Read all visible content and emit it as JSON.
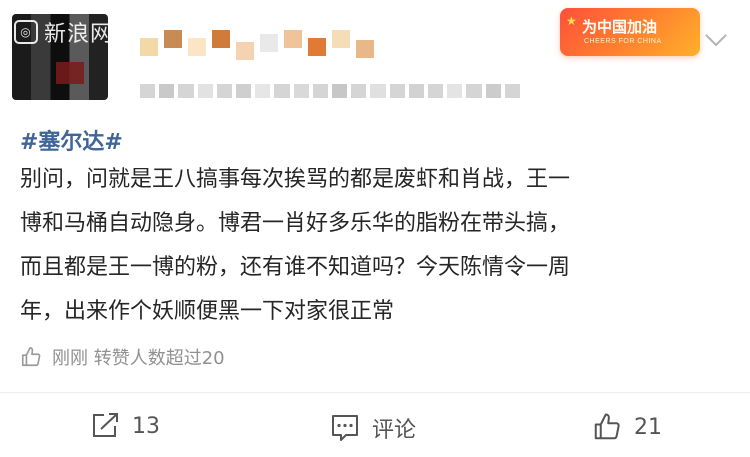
{
  "watermark": {
    "icon": "app-logo-icon",
    "text": "新浪网"
  },
  "badge": {
    "title": "为中国加油",
    "subtitle": "CHEERS FOR CHINA"
  },
  "post": {
    "topic": "#塞尔达#",
    "lines": [
      "别问，问就是王八搞事每次挨骂的都是废虾和肖战，王一",
      "博和马桶自动隐身。博君一肖好多乐华的脂粉在带头搞，",
      "而且都是王一博的粉，还有谁不知道吗？今天陈情令一周",
      "年，出来作个妖顺便黑一下对家很正常"
    ],
    "likes_info": "刚刚 转赞人数超过20"
  },
  "actions": {
    "repost_count": "13",
    "comment_label": "评论",
    "like_count": "21"
  },
  "icons": {
    "repost": "repost-icon",
    "comment": "comment-icon",
    "like": "thumbs-up-icon",
    "more": "chevron-down-icon"
  },
  "colors": {
    "topic": "#406599",
    "badge_start": "#ff4f3a",
    "badge_end": "#ffb02a"
  }
}
